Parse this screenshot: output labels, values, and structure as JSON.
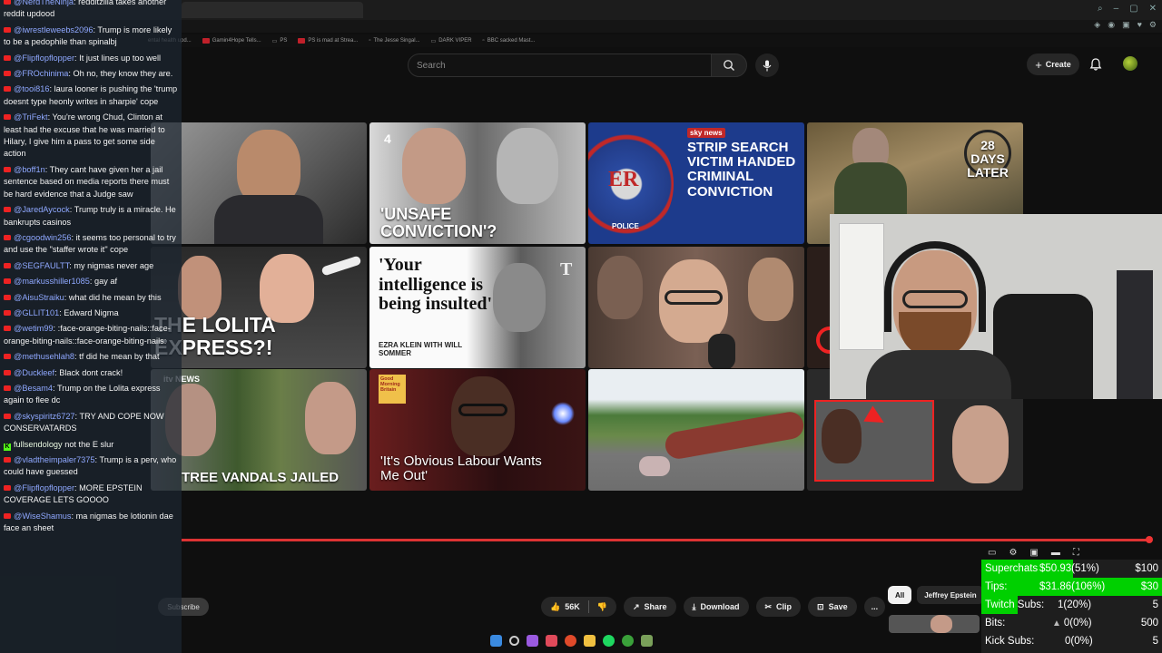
{
  "header": {
    "search_placeholder": "Search",
    "create_label": "Create"
  },
  "bookmarks": [
    "ental health upd...",
    "Gamin4Hope Tells...",
    "PS",
    "PS is mad at Strea...",
    "The Jesse Singal...",
    "DARK VIPER",
    "BBC sacked Mast..."
  ],
  "thumbnails": {
    "t2_badge": "4",
    "t2_title": "'UNSAFE CONVICTION'?",
    "t3_badge": "sky news",
    "t3_title": "STRIP SEARCH VICTIM HANDED CRIMINAL CONVICTION",
    "t3_logo": "ER",
    "t3_police": "POLICE",
    "t4_title": "28 DAYS LATER",
    "t5_title": "THE LOLITA EXPRESS?!",
    "t6_title": "'Your intelligence is being insulted'",
    "t6_byline": "EZRA KLEIN WITH WILL SOMMER",
    "t9_badge": "itv NEWS",
    "t9_title": "TREE VANDALS JAILED",
    "t10_title": "'It's Obvious Labour Wants Me Out'",
    "t10_badge": "Good Morning Britain"
  },
  "actions": {
    "likes": "56K",
    "share": "Share",
    "download": "Download",
    "clip": "Clip",
    "save": "Save",
    "more": "...",
    "subscribe": "Subscribe"
  },
  "chips": [
    "All",
    "Jeffrey Epstein"
  ],
  "chat": [
    {
      "user": "@NerdTheNinja",
      "text": "redditzilla takes another reddit updood"
    },
    {
      "user": "@iwrestleweebs2096",
      "text": "Trump is more likely to be a pedophile than spinalbj"
    },
    {
      "user": "@Flipflopflopper",
      "text": "It just lines up too well"
    },
    {
      "user": "@FROchinima",
      "text": "Oh no, they know they are."
    },
    {
      "user": "@tooi816",
      "text": "laura looner is pushing the 'trump doesnt type heonly writes in sharpie' cope"
    },
    {
      "user": "@TriFekt",
      "text": "You're wrong Chud, Clinton at least had the excuse that he was married to Hilary, I give him a pass to get some side action"
    },
    {
      "user": "@boff1n",
      "text": "They cant have given her a jail sentence based on media reports there must be hard evidence that a Judge saw"
    },
    {
      "user": "@JaredAycock",
      "text": "Trump truly is a miracle. He bankrupts casinos"
    },
    {
      "user": "@cgoodwin256",
      "text": "it seems too personal to try and use the \"staffer wrote it\" cope"
    },
    {
      "user": "@SEGFAULTT",
      "text": "my nigmas never age"
    },
    {
      "user": "@markusshiller1085",
      "text": "gay af"
    },
    {
      "user": "@AisuStraiku",
      "text": "what did he mean by this"
    },
    {
      "user": "@GLLIT101",
      "text": "Edward Nigma"
    },
    {
      "user": "@wetim99",
      "text": ":face-orange-biting-nails::face-orange-biting-nails::face-orange-biting-nails:"
    },
    {
      "user": "@methusehlah8",
      "text": "tf did he mean by that"
    },
    {
      "user": "@Duckleef",
      "text": "Black dont crack!"
    },
    {
      "user": "@Besam4",
      "text": "Trump on the Lolita express again to flee dc"
    },
    {
      "user": "@skyspiritz6727",
      "text": "TRY AND COPE NOW CONSERVATARDS"
    },
    {
      "user": "fullsendology",
      "text": "not the E slur",
      "platform": "kick"
    },
    {
      "user": "@vladtheimpaler7375",
      "text": "Trump is a perv, who could have guessed"
    },
    {
      "user": "@Flipflopflopper",
      "text": "MORE EPSTEIN COVERAGE LETS GOOOO"
    },
    {
      "user": "@WiseShamus",
      "text": "ma nigmas be lotionin dae face an sheet"
    }
  ],
  "stats": {
    "superchats": {
      "label": "Superchats",
      "value": "$50.93(51%)",
      "goal": "$100",
      "progress": 0.51
    },
    "tips": {
      "label": "Tips:",
      "value": "$31.86(106%)",
      "goal": "$30",
      "progress": 1.0
    },
    "twitch": {
      "label": "Twitch Subs:",
      "value": "1(20%)",
      "goal": "5",
      "progress": 0.2
    },
    "bits": {
      "label": "Bits:",
      "value": "0(0%)",
      "goal": "500",
      "progress": 0
    },
    "kick": {
      "label": "Kick Subs:",
      "value": "0(0%)",
      "goal": "5",
      "progress": 0
    }
  },
  "colors": {
    "chat_user": "#8fa8ff",
    "progress_bar": "#dd3333",
    "stats_fill": "#00d000"
  }
}
